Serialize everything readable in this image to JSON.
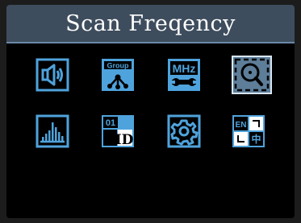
{
  "screen": {
    "title": "Scan Freqency"
  },
  "menu": {
    "items": [
      {
        "icon": "speaker-icon",
        "selected": false
      },
      {
        "icon": "group-icon",
        "label": "Group",
        "selected": false
      },
      {
        "icon": "mhz-wrench-icon",
        "label": "MHz",
        "selected": false
      },
      {
        "icon": "scan-search-icon",
        "selected": true
      },
      {
        "icon": "equalizer-bars-icon",
        "selected": false
      },
      {
        "icon": "id-icon",
        "label_top": "01",
        "label_bottom": "ID",
        "selected": false
      },
      {
        "icon": "gear-icon",
        "selected": false
      },
      {
        "icon": "language-icon",
        "label_en": "EN",
        "label_cn": "中",
        "selected": false
      }
    ]
  },
  "colors": {
    "header_bg": "#3e4d5d",
    "icon_blue": "#4fa3dc",
    "selected_bg": "#5d7d99",
    "screen_bg": "#000000"
  }
}
